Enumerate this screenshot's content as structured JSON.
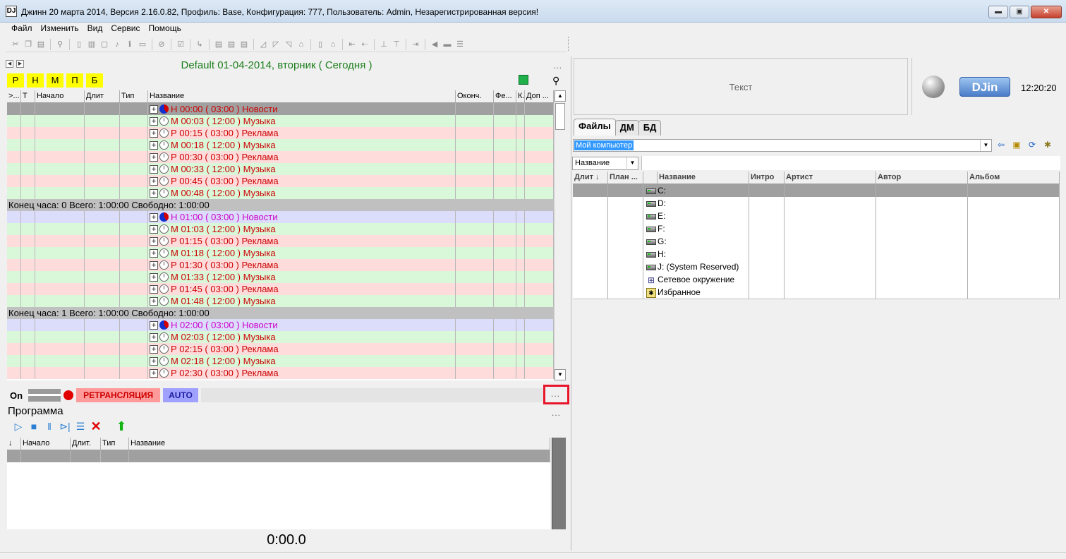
{
  "window": {
    "title": "Джинн 20 марта 2014, Версия 2.16.0.82, Профиль: Base, Конфигурация: 777, Пользователь: Admin, Незарегистрированная версия!",
    "icon_label": "DJ",
    "minimize": "▬",
    "maximize": "▣",
    "close": "✕"
  },
  "menu": [
    "Файл",
    "Изменить",
    "Вид",
    "Сервис",
    "Помощь"
  ],
  "schedule": {
    "date_title": "Default 01-04-2014, вторник ( Сегодня )",
    "more": "...",
    "filters": [
      "Р",
      "Н",
      "М",
      "П",
      "Б"
    ],
    "columns": [
      ">...",
      "Т",
      "Начало",
      "Длит",
      "Тип",
      "Название",
      "Оконч.",
      "Фе...",
      "К.",
      "Доп ..."
    ],
    "rows": [
      {
        "kind": "item",
        "style": "sel",
        "icon": "pie",
        "name": "Н 00:00 ( 03:00 ) Новости"
      },
      {
        "kind": "item",
        "style": "green",
        "icon": "clock",
        "name": "М 00:03 ( 12:00 ) Музыка"
      },
      {
        "kind": "item",
        "style": "pink",
        "icon": "clock",
        "name": "Р 00:15 ( 03:00 ) Реклама"
      },
      {
        "kind": "item",
        "style": "green",
        "icon": "clock",
        "name": "М 00:18 ( 12:00 ) Музыка"
      },
      {
        "kind": "item",
        "style": "pink",
        "icon": "clock",
        "name": "Р 00:30 ( 03:00 ) Реклама"
      },
      {
        "kind": "item",
        "style": "green",
        "icon": "clock",
        "name": "М 00:33 ( 12:00 ) Музыка"
      },
      {
        "kind": "item",
        "style": "pink",
        "icon": "clock",
        "name": "Р 00:45 ( 03:00 ) Реклама"
      },
      {
        "kind": "item",
        "style": "green",
        "icon": "clock",
        "name": "М 00:48 ( 12:00 ) Музыка"
      },
      {
        "kind": "hour",
        "text": "Конец часа: 0 Всего: 1:00:00 Свободно:  1:00:00"
      },
      {
        "kind": "item",
        "style": "blue",
        "icon": "pie",
        "name": "Н 01:00 ( 03:00 ) Новости"
      },
      {
        "kind": "item",
        "style": "green",
        "icon": "clock",
        "name": "М 01:03 ( 12:00 ) Музыка"
      },
      {
        "kind": "item",
        "style": "pink",
        "icon": "clock",
        "name": "Р 01:15 ( 03:00 ) Реклама"
      },
      {
        "kind": "item",
        "style": "green",
        "icon": "clock",
        "name": "М 01:18 ( 12:00 ) Музыка"
      },
      {
        "kind": "item",
        "style": "pink",
        "icon": "clock",
        "name": "Р 01:30 ( 03:00 ) Реклама"
      },
      {
        "kind": "item",
        "style": "green",
        "icon": "clock",
        "name": "М 01:33 ( 12:00 ) Музыка"
      },
      {
        "kind": "item",
        "style": "pink",
        "icon": "clock",
        "name": "Р 01:45 ( 03:00 ) Реклама"
      },
      {
        "kind": "item",
        "style": "green",
        "icon": "clock",
        "name": "М 01:48 ( 12:00 ) Музыка"
      },
      {
        "kind": "hour",
        "text": "Конец часа: 1 Всего: 1:00:00 Свободно:  1:00:00"
      },
      {
        "kind": "item",
        "style": "blue",
        "icon": "pie",
        "name": "Н 02:00 ( 03:00 ) Новости"
      },
      {
        "kind": "item",
        "style": "green",
        "icon": "clock",
        "name": "М 02:03 ( 12:00 ) Музыка"
      },
      {
        "kind": "item",
        "style": "pink",
        "icon": "clock",
        "name": "Р 02:15 ( 03:00 ) Реклама"
      },
      {
        "kind": "item",
        "style": "green",
        "icon": "clock",
        "name": "М 02:18 ( 12:00 ) Музыка"
      },
      {
        "kind": "item",
        "style": "pink",
        "icon": "clock",
        "name": "Р 02:30 ( 03:00 ) Реклама"
      }
    ]
  },
  "status": {
    "on_label": "On",
    "relay_label": "РЕТРАНСЛЯЦИЯ",
    "auto_label": "AUTO",
    "more": "...",
    "highlight_color": "#e8162b"
  },
  "program": {
    "title": "Программа",
    "more": "...",
    "columns": [
      "",
      "Начало",
      "Длит.",
      "Тип",
      "Название"
    ],
    "timer": "0:00.0"
  },
  "right": {
    "text_placeholder": "Текст",
    "logo": "DJin",
    "time": "12:20:20",
    "tabs": [
      "Файлы",
      "ДМ",
      "БД"
    ],
    "path_value": "Мой компьютер",
    "sort_value": "Название",
    "file_columns": [
      "Длит",
      "План ...",
      "",
      "Название",
      "Интро",
      "Артист",
      "Автор",
      "Альбом"
    ],
    "files": [
      {
        "icon": "drive",
        "name": "C:"
      },
      {
        "icon": "drive",
        "name": "D:"
      },
      {
        "icon": "drive",
        "name": "E:"
      },
      {
        "icon": "drive",
        "name": "F:"
      },
      {
        "icon": "drive",
        "name": "G:"
      },
      {
        "icon": "drive",
        "name": "H:"
      },
      {
        "icon": "drive",
        "name": "J: (System Reserved)"
      },
      {
        "icon": "network",
        "name": "Сетевое окружение"
      },
      {
        "icon": "favorites",
        "name": "Избранное"
      }
    ]
  },
  "colors": {
    "row_green": "#d9f8d9",
    "row_pink": "#ffdcdc",
    "row_blue": "#dcdcfb",
    "row_selected": "#a0a0a0",
    "date_title": "#1d7f1d",
    "filter_yellow": "#ffff00"
  }
}
